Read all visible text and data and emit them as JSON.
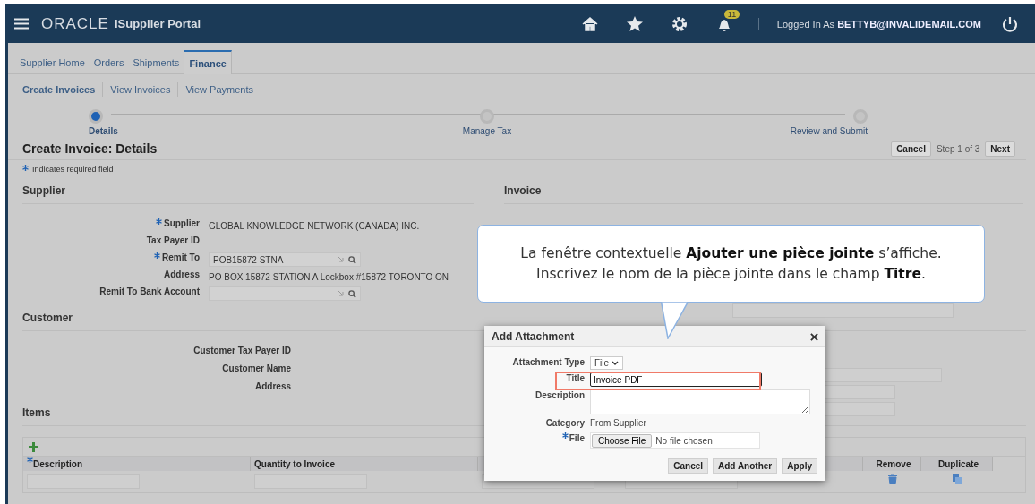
{
  "header": {
    "logo": "ORACLE",
    "product": "iSupplier Portal",
    "notification_count": "11",
    "logged_in_label": "Logged In As",
    "user": "BETTYB@INVALIDEMAIL.COM"
  },
  "tabs": [
    {
      "label": "Supplier Home",
      "selected": false
    },
    {
      "label": "Orders",
      "selected": false
    },
    {
      "label": "Shipments",
      "selected": false
    },
    {
      "label": "Finance",
      "selected": true
    }
  ],
  "subtabs": [
    {
      "label": "Create Invoices",
      "selected": true
    },
    {
      "label": "View Invoices",
      "selected": false
    },
    {
      "label": "View Payments",
      "selected": false
    }
  ],
  "steps": [
    {
      "label": "Details",
      "selected": true
    },
    {
      "label": "Manage Tax",
      "selected": false
    },
    {
      "label": "Review and Submit",
      "selected": false
    }
  ],
  "page_title": "Create Invoice: Details",
  "actions": {
    "cancel": "Cancel",
    "step": "Step 1 of 3",
    "next": "Next"
  },
  "required_note": "Indicates required field",
  "supplier": {
    "heading": "Supplier",
    "fields": [
      {
        "label": "Supplier",
        "required": true,
        "kind": "text",
        "value": "GLOBAL KNOWLEDGE NETWORK (CANADA) INC."
      },
      {
        "label": "Tax Payer ID",
        "required": false,
        "kind": "text"
      },
      {
        "label": "Remit To",
        "required": true,
        "kind": "lov",
        "value": "POB15872 STNA"
      },
      {
        "label": "Address",
        "required": false,
        "kind": "text",
        "value": "PO BOX 15872 STATION A Lockbox #15872 TORONTO ON"
      },
      {
        "label": "Remit To Bank Account",
        "required": false,
        "kind": "lov"
      }
    ]
  },
  "invoice": {
    "heading": "Invoice"
  },
  "customer": {
    "heading": "Customer",
    "fields": [
      {
        "label": "Customer Tax Payer ID"
      },
      {
        "label": "Customer Name"
      },
      {
        "label": "Address"
      }
    ]
  },
  "items": {
    "heading": "Items",
    "columns": [
      {
        "label": "Description",
        "required": true,
        "kind": "input"
      },
      {
        "label": "Quantity to Invoice",
        "required": false,
        "kind": "input"
      },
      {
        "kind": "input"
      },
      {
        "kind": "input"
      },
      {
        "label": "Remove",
        "kind": "remove"
      },
      {
        "label": "Duplicate",
        "kind": "duplicate"
      }
    ]
  },
  "callout": {
    "text": "La fenêtre contextuelle **Ajouter une pièce jointe** s’affiche.\nInscrivez le nom de la pièce jointe dans le champ **Titre**."
  },
  "dialog": {
    "title": "Add Attachment",
    "fields": [
      {
        "label": "Attachment Type",
        "kind": "select",
        "value": "File"
      },
      {
        "label": "Title",
        "kind": "input",
        "value": "Invoice PDF",
        "highlighted": true
      },
      {
        "label": "Description",
        "kind": "textarea"
      },
      {
        "label": "Category",
        "kind": "text",
        "value": "From Supplier"
      },
      {
        "label": "File",
        "kind": "file",
        "required": true,
        "button": "Choose File",
        "value": "No file chosen"
      }
    ],
    "buttons": [
      "Cancel",
      "Add Another",
      "Apply"
    ]
  }
}
